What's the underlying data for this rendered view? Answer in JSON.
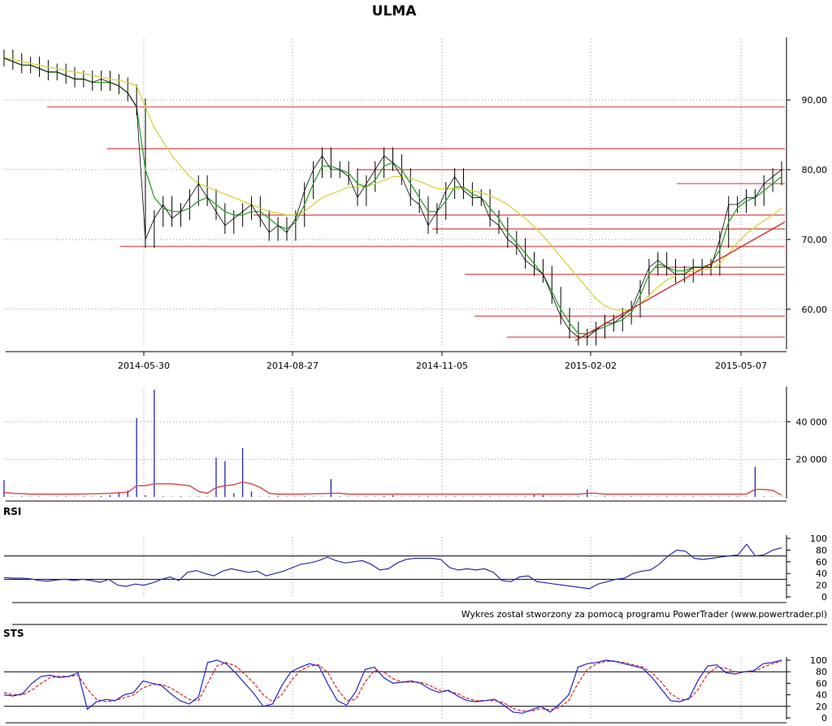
{
  "colors": {
    "price_bar": "#000000",
    "sma_short": "#2e9e2e",
    "sma_long": "#d4d43a",
    "support_resistance": "#e07070",
    "trend_line": "#cc2020",
    "volume_bar": "#2222aa",
    "volume_avg": "#dd4444",
    "rsi_line": "#2a2aaa",
    "sts_k": "#2222cc",
    "sts_d": "#dd2222",
    "grid": "#999999",
    "axis": "#000000"
  },
  "chart_data": [
    {
      "panel": "price",
      "type": "line",
      "title": "ULMA",
      "x_tick_labels": [
        "2014-05-30",
        "2014-08-27",
        "2014-11-05",
        "2015-02-02",
        "2015-05-07"
      ],
      "y_tick_labels": [
        "90,00",
        "80,00",
        "70,00",
        "60,00"
      ],
      "y_ticks": [
        90,
        80,
        70,
        60
      ],
      "ylim": [
        54.5,
        98.5
      ],
      "grid": true,
      "series": [
        {
          "role": "close",
          "values": [
            96,
            95.5,
            95,
            95,
            94.5,
            94,
            94,
            93.5,
            93,
            93,
            92.5,
            93,
            92.5,
            92,
            91,
            89,
            70,
            73,
            75,
            73,
            74,
            76,
            78,
            76,
            74,
            72,
            73,
            74,
            75,
            73,
            71,
            72,
            71,
            73,
            77,
            80,
            82,
            80,
            80,
            79,
            76,
            78,
            80,
            82,
            81,
            79,
            76,
            75,
            72,
            74,
            77,
            79,
            77,
            76,
            76,
            73,
            72,
            70,
            69,
            67,
            66,
            65,
            62,
            59,
            57,
            56,
            56,
            57,
            58,
            58,
            59,
            60,
            63,
            66,
            67,
            66,
            65,
            65,
            66,
            66,
            66,
            70,
            75,
            75,
            76,
            76,
            78,
            79,
            80
          ]
        },
        {
          "role": "sma_short",
          "values": [
            96,
            95.5,
            95,
            95,
            94.5,
            94,
            94,
            93.5,
            93,
            93,
            92.5,
            92.5,
            92.5,
            92,
            91,
            89,
            80,
            76,
            74.5,
            74,
            74,
            74.5,
            75.5,
            76,
            75,
            74,
            73.5,
            73.5,
            74,
            74,
            73,
            72,
            71.5,
            72.5,
            75,
            78,
            80.5,
            80.5,
            80,
            79.5,
            78,
            77.5,
            78.5,
            80.5,
            81,
            80,
            78,
            76,
            74,
            74,
            75.5,
            77.5,
            77.5,
            76.5,
            76,
            74.5,
            73,
            71,
            69.5,
            68,
            66.5,
            65,
            62.5,
            60,
            58,
            56.5,
            56.5,
            57,
            57.5,
            58,
            58.5,
            59.5,
            62,
            65,
            66.5,
            66,
            65.5,
            65.5,
            66,
            66,
            66.5,
            68.5,
            72.5,
            74.5,
            75.5,
            76,
            77,
            78,
            79
          ]
        },
        {
          "role": "sma_long",
          "values": [
            96,
            95.8,
            95.5,
            95.2,
            95,
            94.7,
            94.5,
            94.2,
            94,
            93.8,
            93.5,
            93.3,
            93,
            92.8,
            92.5,
            92,
            89,
            86,
            84,
            82,
            80.5,
            79,
            78,
            77.5,
            77,
            76.5,
            76,
            75.5,
            75,
            74.5,
            74,
            73.8,
            73.5,
            73.5,
            74,
            75,
            76,
            76.5,
            77,
            77.5,
            77.5,
            77.6,
            78,
            78.5,
            79,
            79,
            78.8,
            78.3,
            77.8,
            77.3,
            77.2,
            77.3,
            77.2,
            77,
            76.7,
            76.3,
            75.7,
            75,
            74,
            73,
            71.8,
            70.5,
            69,
            67.5,
            66,
            64.5,
            63,
            61.5,
            60.5,
            60,
            59.8,
            60,
            60.8,
            62,
            63.2,
            64.2,
            64.8,
            65.2,
            65.5,
            65.6,
            65.8,
            66.5,
            68,
            69.5,
            70.8,
            71.8,
            72.7,
            73.5,
            74.5
          ]
        }
      ],
      "support_resistance_levels": [
        89,
        83,
        80,
        78,
        73.5,
        71.5,
        69,
        66,
        65,
        59,
        56
      ],
      "trend_line": {
        "from": 55.5,
        "to": 72.5
      }
    },
    {
      "panel": "volume",
      "type": "bar",
      "y_tick_labels": [
        "40 000",
        "20 000"
      ],
      "y_ticks": [
        40000,
        20000
      ],
      "ylim": [
        0,
        57000
      ],
      "grid": true,
      "series": [
        {
          "role": "volume",
          "values": [
            9000,
            200,
            300,
            200,
            200,
            100,
            200,
            300,
            200,
            300,
            200,
            500,
            1000,
            2000,
            3500,
            42000,
            1000,
            57000,
            300,
            200,
            400,
            200,
            300,
            200,
            21000,
            19000,
            2000,
            26000,
            3000,
            200,
            300,
            400,
            200,
            200,
            300,
            200,
            200,
            9500,
            300,
            200,
            200,
            300,
            200,
            500,
            1000,
            200,
            200,
            300,
            400,
            200,
            300,
            300,
            200,
            200,
            200,
            300,
            200,
            200,
            200,
            300,
            1500,
            1000,
            200,
            200,
            200,
            300,
            4000,
            200,
            300,
            200,
            200,
            300,
            200,
            200,
            200,
            300,
            200,
            200,
            300,
            200,
            200,
            200,
            200,
            300,
            200,
            16000,
            300,
            200,
            200
          ]
        },
        {
          "role": "volume_avg",
          "values": [
            2500,
            2000,
            1800,
            1500,
            1500,
            1500,
            1500,
            1500,
            1500,
            1600,
            1700,
            1800,
            2000,
            2300,
            2500,
            6000,
            6000,
            7000,
            7000,
            7000,
            6500,
            6000,
            3000,
            2000,
            5000,
            6000,
            6500,
            8000,
            7000,
            5000,
            2000,
            1500,
            1500,
            1500,
            1600,
            1700,
            1800,
            2000,
            2000,
            1500,
            1500,
            1500,
            1500,
            1500,
            1500,
            1500,
            1500,
            1500,
            1500,
            1500,
            1500,
            1500,
            1500,
            1500,
            1500,
            1500,
            1500,
            1500,
            1500,
            1500,
            1500,
            1500,
            1500,
            1500,
            1500,
            1500,
            2000,
            2000,
            1500,
            1500,
            1500,
            1500,
            1500,
            1500,
            1500,
            1500,
            1500,
            1500,
            1500,
            1500,
            1500,
            1500,
            1500,
            1500,
            1500,
            4000,
            4000,
            3500,
            1000
          ]
        }
      ]
    },
    {
      "panel": "rsi",
      "type": "line",
      "label": "RSI",
      "y_tick_labels": [
        "100",
        "80",
        "60",
        "40",
        "20",
        "0"
      ],
      "y_ticks": [
        100,
        80,
        60,
        40,
        20,
        0
      ],
      "ylim": [
        0,
        100
      ],
      "reference_lines": [
        70,
        30
      ],
      "grid": true,
      "series": [
        {
          "role": "rsi",
          "values": [
            33,
            32,
            32,
            31,
            28,
            27,
            29,
            30,
            28,
            30,
            28,
            25,
            30,
            20,
            18,
            22,
            20,
            24,
            30,
            34,
            28,
            42,
            45,
            40,
            36,
            44,
            48,
            45,
            42,
            44,
            36,
            40,
            44,
            50,
            56,
            58,
            62,
            68,
            62,
            58,
            60,
            62,
            56,
            46,
            48,
            58,
            64,
            66,
            66,
            66,
            64,
            50,
            46,
            48,
            46,
            48,
            42,
            28,
            26,
            34,
            36,
            26,
            24,
            22,
            20,
            18,
            16,
            14,
            22,
            26,
            30,
            32,
            40,
            44,
            46,
            56,
            70,
            80,
            78,
            66,
            64,
            66,
            68,
            70,
            72,
            90,
            70,
            72,
            80,
            84
          ]
        }
      ]
    },
    {
      "panel": "sts",
      "type": "line",
      "label": "STS",
      "y_tick_labels": [
        "100",
        "80",
        "60",
        "40",
        "20",
        "0"
      ],
      "y_ticks": [
        100,
        80,
        60,
        40,
        20,
        0
      ],
      "ylim": [
        0,
        100
      ],
      "reference_lines": [
        80,
        20
      ],
      "grid": true,
      "series": [
        {
          "role": "stochastic_k",
          "values": [
            40,
            38,
            42,
            60,
            72,
            74,
            70,
            72,
            78,
            15,
            28,
            32,
            30,
            40,
            44,
            64,
            60,
            56,
            42,
            30,
            24,
            36,
            96,
            100,
            94,
            78,
            60,
            42,
            20,
            24,
            56,
            80,
            88,
            94,
            90,
            58,
            30,
            22,
            46,
            84,
            88,
            70,
            60,
            62,
            64,
            60,
            50,
            44,
            48,
            38,
            30,
            28,
            30,
            32,
            22,
            10,
            8,
            14,
            20,
            10,
            24,
            40,
            88,
            94,
            96,
            100,
            98,
            94,
            90,
            86,
            70,
            50,
            30,
            28,
            34,
            66,
            90,
            92,
            78,
            76,
            80,
            82,
            94,
            96,
            100
          ]
        },
        {
          "role": "stochastic_d",
          "values": [
            44,
            40,
            40,
            48,
            60,
            70,
            72,
            72,
            74,
            50,
            32,
            28,
            30,
            35,
            40,
            52,
            58,
            58,
            52,
            42,
            32,
            30,
            60,
            90,
            96,
            90,
            76,
            60,
            40,
            28,
            40,
            64,
            82,
            90,
            92,
            78,
            50,
            30,
            32,
            62,
            82,
            80,
            68,
            62,
            62,
            62,
            56,
            48,
            46,
            42,
            34,
            30,
            30,
            30,
            26,
            16,
            12,
            12,
            16,
            14,
            18,
            30,
            60,
            84,
            94,
            98,
            98,
            96,
            92,
            88,
            78,
            62,
            42,
            32,
            32,
            50,
            76,
            88,
            86,
            80,
            80,
            80,
            88,
            94,
            98
          ]
        }
      ]
    }
  ],
  "credit_text": "Wykres został stworzony za pomocą programu PowerTrader (www.powertrader.pl)"
}
